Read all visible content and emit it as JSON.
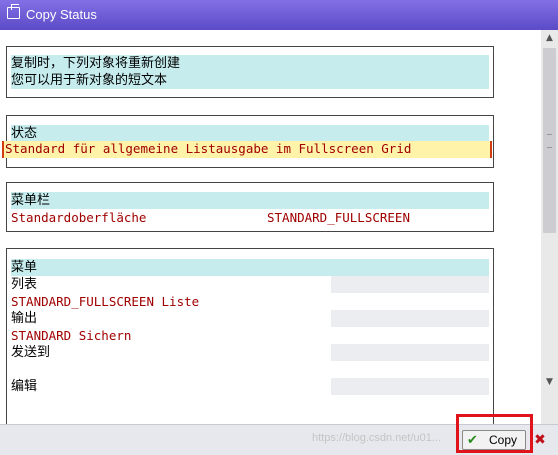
{
  "window": {
    "title": "Copy Status",
    "title_icon": "copy-icon"
  },
  "notice": {
    "line1": "复制时，下列对象将重新创建",
    "line2": "您可以用于新对象的短文本"
  },
  "status_group": {
    "heading": "状态",
    "value": "Standard für allgemeine Listausgabe im Fullscreen Grid"
  },
  "menubar_group": {
    "heading": "菜单栏",
    "text": "Standardoberfläche",
    "name": "STANDARD_FULLSCREEN"
  },
  "menu_group": {
    "heading": "菜单",
    "items": [
      {
        "label": "列表",
        "text": "STANDARD_FULLSCREEN Liste"
      },
      {
        "label": "输出",
        "text": "STANDARD Sichern"
      },
      {
        "label": "发送到",
        "text": ""
      },
      {
        "label": "编辑",
        "text": ""
      }
    ]
  },
  "footer": {
    "copy_label": "Copy",
    "watermark": "https://blog.csdn.net/u01..."
  },
  "colors": {
    "titlebar": "#6a5ad8",
    "highlight_border": "#e0131a",
    "field_text": "#a00000",
    "cyan_row": "#c6ecee",
    "input_field": "#fff3aa"
  }
}
